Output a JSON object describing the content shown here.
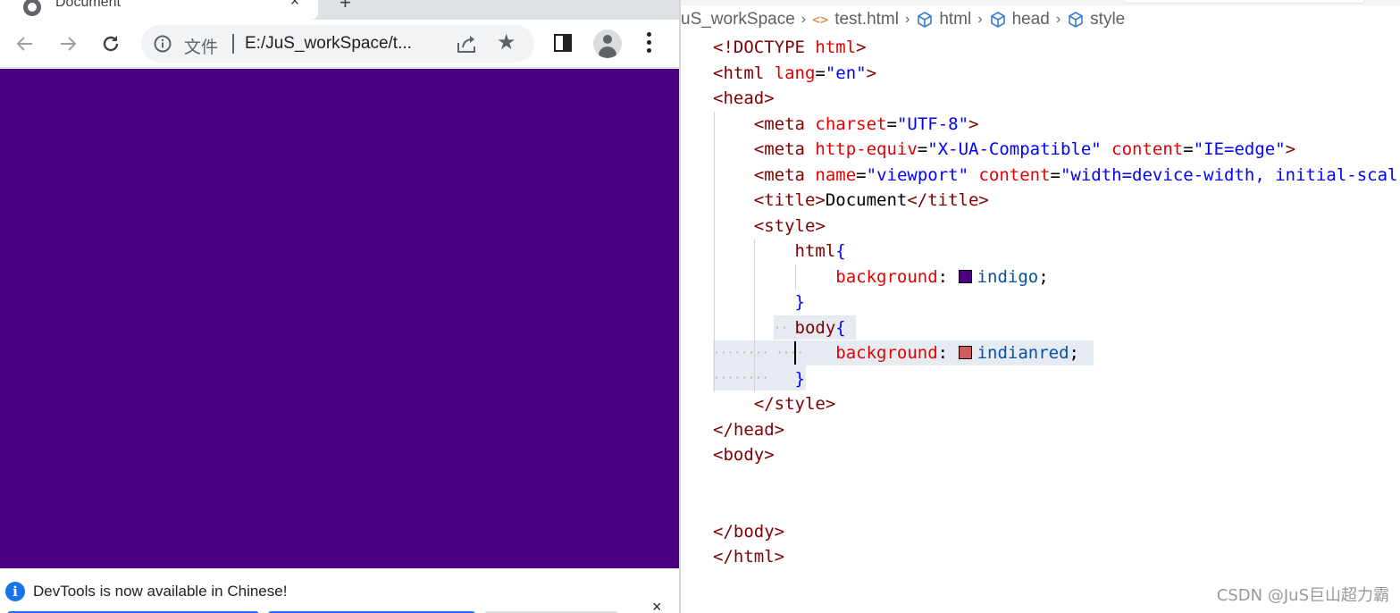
{
  "browser": {
    "tab": {
      "title": "Document",
      "close_icon": "×"
    },
    "new_tab_icon": "+",
    "toolbar": {
      "back_icon": "arrow-left",
      "forward_icon": "arrow-right",
      "reload_icon": "reload",
      "site_info_label": "文件",
      "url": "E:/JuS_workSpace/t...",
      "share_icon": "share",
      "bookmark_icon": "★",
      "side_panel_icon": "side-panel",
      "profile_icon": "profile",
      "menu_icon": "more-vert"
    },
    "page_background": "#4b0082",
    "devtools_notice": {
      "icon": "i",
      "message": "DevTools is now available in Chinese!",
      "close": "×"
    }
  },
  "editor": {
    "breadcrumb": [
      {
        "label": "uS_workSpace",
        "icon": ""
      },
      {
        "label": "test.html",
        "icon": "<>"
      },
      {
        "label": "html",
        "icon": "cube"
      },
      {
        "label": "head",
        "icon": "cube"
      },
      {
        "label": "style",
        "icon": "cube"
      }
    ],
    "code": {
      "l1": {
        "a": "<!DOCTYPE ",
        "b": "html",
        "c": ">"
      },
      "l2": {
        "a": "<html ",
        "b": "lang",
        "c": "=",
        "d": "\"en\"",
        "e": ">"
      },
      "l3": {
        "a": "<head>"
      },
      "l4": {
        "a": "<meta ",
        "b": "charset",
        "c": "=",
        "d": "\"UTF-8\"",
        "e": ">"
      },
      "l5": {
        "a": "<meta ",
        "b": "http-equiv",
        "c": "=",
        "d": "\"X-UA-Compatible\"",
        "e": " content",
        "f": "=",
        "g": "\"IE=edge\"",
        "h": ">"
      },
      "l6": {
        "a": "<meta ",
        "b": "name",
        "c": "=",
        "d": "\"viewport\"",
        "e": " content",
        "f": "=",
        "g": "\"width=device-width, initial-scal"
      },
      "l7": {
        "a": "<title>",
        "b": "Document",
        "c": "</title>"
      },
      "l8": {
        "a": "<style>"
      },
      "l9": {
        "a": "html",
        "b": "{"
      },
      "l10": {
        "a": "background",
        "b": ": ",
        "c": "indigo",
        "d": ";",
        "swatch": "#4b0082"
      },
      "l11": {
        "a": "}"
      },
      "l12": {
        "a": "body",
        "b": "{"
      },
      "l13": {
        "a": "background",
        "b": ": ",
        "c": "indianred",
        "d": ";",
        "swatch": "#cd5c5c"
      },
      "l14": {
        "a": "}"
      },
      "l15": {
        "a": "</style>"
      },
      "l16": {
        "a": "</head>"
      },
      "l17": {
        "a": "<body>"
      },
      "l18": {
        "a": ""
      },
      "l19": {
        "a": ""
      },
      "l20": {
        "a": "</body>"
      },
      "l21": {
        "a": "</html>"
      }
    }
  },
  "watermark": "CSDN @JuS巨山超力霸"
}
